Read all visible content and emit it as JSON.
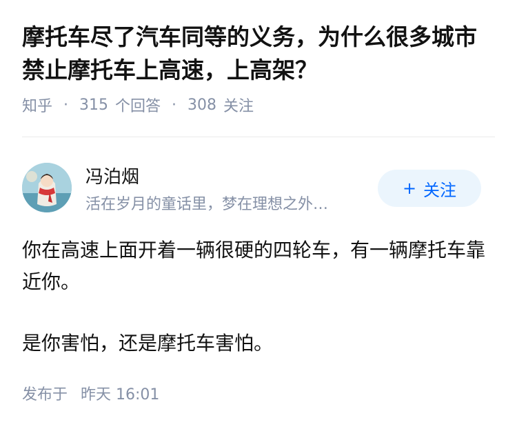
{
  "question": {
    "title": "摩托车尽了汽车同等的义务，为什么很多城市禁止摩托车上高速，上高架？",
    "source": "知乎",
    "separator": "·",
    "answer_count": "315",
    "answer_label": "个回答",
    "follower_count": "308",
    "follower_label": "关注"
  },
  "answer": {
    "author": {
      "name": "冯泊烟",
      "bio": "活在岁月的童话里，梦在理想之外…",
      "avatar_icon": "avatar-girl-red-scarf"
    },
    "follow_button": {
      "plus": "+",
      "label": "关注"
    },
    "paragraphs": [
      "你在高速上面开着一辆很硬的四轮车，有一辆摩托车靠近你。",
      "是你害怕，还是摩托车害怕。"
    ],
    "publish_label": "发布于",
    "publish_time": "昨天 16:01"
  },
  "colors": {
    "primary_text": "#121212",
    "secondary_text": "#8590a6",
    "accent_blue": "#0066ff",
    "button_bg": "#ebf5fd",
    "divider": "#ebebeb"
  }
}
